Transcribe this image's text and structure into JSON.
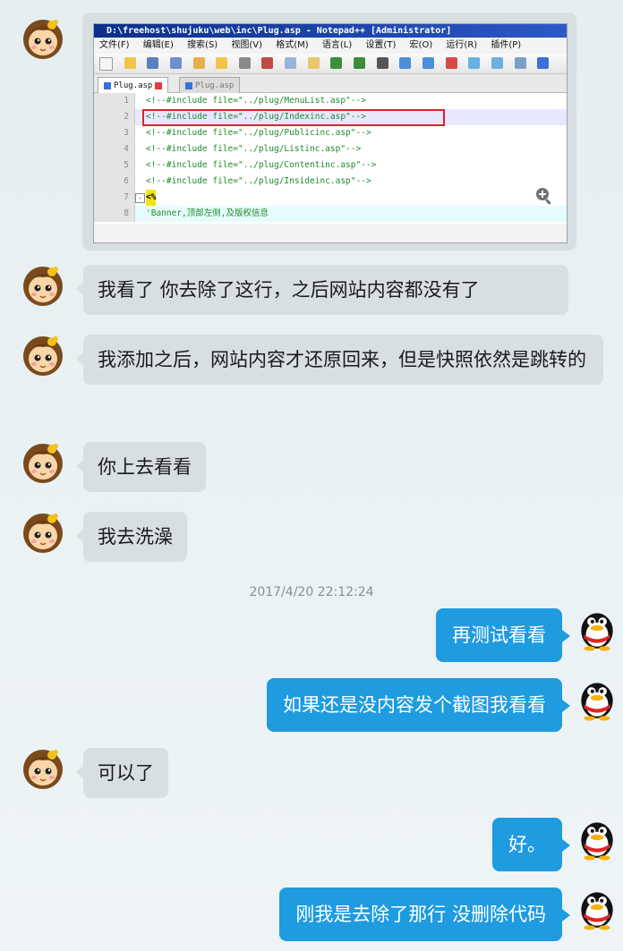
{
  "screenshot": {
    "window_title": "D:\\freehost\\shujuku\\web\\inc\\Plug.asp - Notepad++ [Administrator]",
    "menu": [
      "文件(F)",
      "编辑(E)",
      "搜索(S)",
      "视图(V)",
      "格式(M)",
      "语言(L)",
      "设置(T)",
      "宏(O)",
      "运行(R)",
      "插件(P)"
    ],
    "tabs": [
      "Plug.asp",
      "Plug.asp"
    ],
    "lines": [
      {
        "num": "1",
        "code": "<!--#include file=\"../plug/MenuList.asp\"-->"
      },
      {
        "num": "2",
        "code": "<!--#include file=\"../plug/Indexinc.asp\"-->"
      },
      {
        "num": "3",
        "code": "<!--#include file=\"../plug/Publicinc.asp\"-->"
      },
      {
        "num": "4",
        "code": "<!--#include file=\"../plug/Listinc.asp\"-->"
      },
      {
        "num": "5",
        "code": "<!--#include file=\"../plug/Contentinc.asp\"-->"
      },
      {
        "num": "6",
        "code": "<!--#include file=\"../plug/Insideinc.asp\"-->"
      },
      {
        "num": "7",
        "code": "<%"
      },
      {
        "num": "8",
        "code": "'Banner,顶部左侧,及版权信息"
      }
    ]
  },
  "messages_left": [
    "我看了  你去除了这行，之后网站内容都没有了",
    "我添加之后，网站内容才还原回来，但是快照依然是跳转的",
    "你上去看看",
    "我去洗澡",
    "可以了"
  ],
  "timestamp": "2017/4/20 22:12:24",
  "messages_right": [
    "再测试看看",
    "如果还是没内容发个截图我看看",
    "好。",
    "刚我是去除了那行 没删除代码"
  ],
  "colors": {
    "incoming_bubble": "#d7dfe3",
    "outgoing_bubble": "#1f9be0",
    "background": "#e9f1f4"
  }
}
